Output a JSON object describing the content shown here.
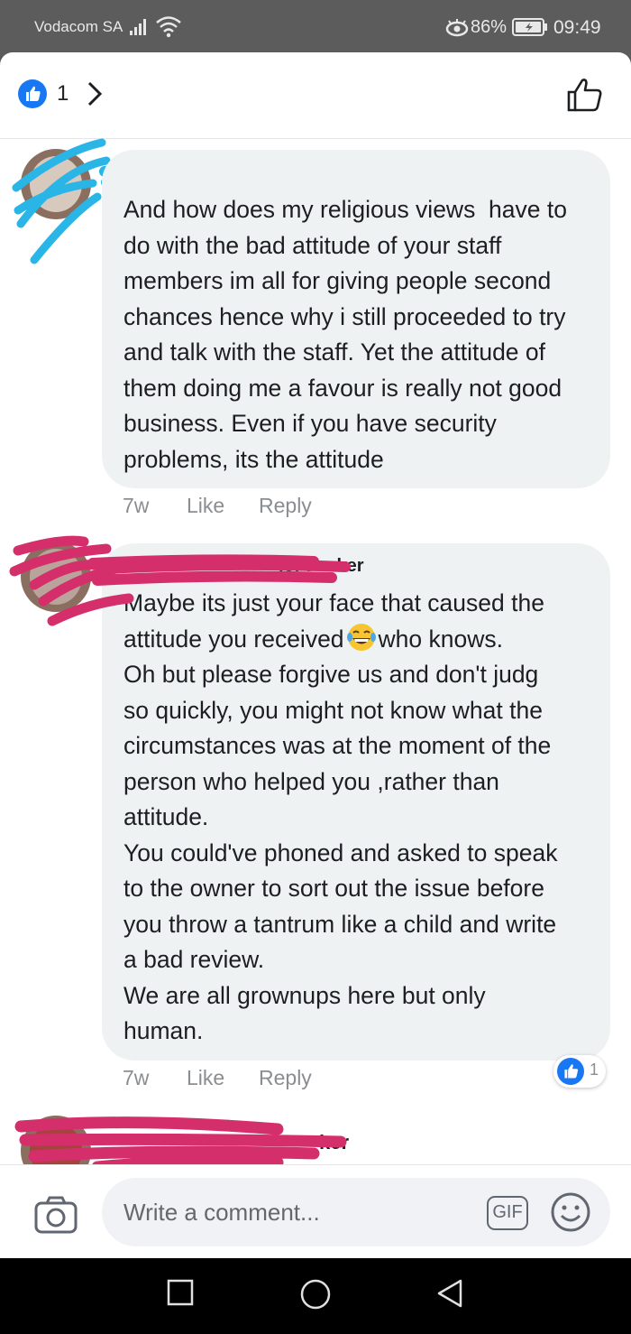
{
  "status_bar": {
    "carrier": "Vodacom SA",
    "battery": "86%",
    "time": "09:49"
  },
  "header": {
    "reaction_count": "1"
  },
  "comments": [
    {
      "text": "And how does my religious views  have to\ndo with the bad attitude of your staff\nmembers im all for giving people second\nchances hence why i still proceeded to try\nand talk with the staff. Yet the attitude of\nthem doing me a favour is really not good\nbusiness. Even if you have security\nproblems, its the attitude",
      "age": "7w",
      "like": "Like",
      "reply": "Reply"
    },
    {
      "name_fragment": "joi Jonker",
      "text_before_emoji": "Maybe its just your face that caused the\nattitude you received",
      "text_after_emoji": "who knows.\nOh but please forgive us and don't judg\nso quickly, you might not know what the\ncircumstances was at the moment of the\nperson who helped you ,rather than\nattitude.\nYou could've phoned and asked to speak\nto the owner to sort out the issue before\nyou throw a tantrum like a child and write\na bad review.\nWe are all grownups here but only\nhuman.",
      "age": "7w",
      "like": "Like",
      "reply": "Reply",
      "reaction_count": "1"
    },
    {
      "name_fragment": "ker"
    }
  ],
  "composer": {
    "placeholder": "Write a comment...",
    "gif_label": "GIF"
  }
}
